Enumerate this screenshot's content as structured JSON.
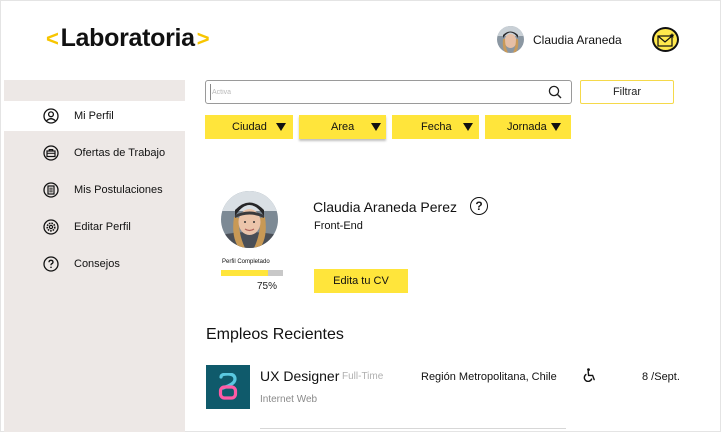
{
  "brand": {
    "left_bracket": "<",
    "name": "Laboratoria",
    "right_bracket": ">",
    "accent": "#f7c500"
  },
  "user": {
    "name": "Claudia Araneda",
    "avatar_icon": "user-photo",
    "notification_icon": "mail-star-icon"
  },
  "sidebar": {
    "items": [
      {
        "label": "Mi Perfil",
        "icon": "user-icon",
        "active": true
      },
      {
        "label": "Ofertas de Trabajo",
        "icon": "briefcase-icon",
        "active": false
      },
      {
        "label": "Mis Postulaciones",
        "icon": "document-icon",
        "active": false
      },
      {
        "label": "Editar Perfil",
        "icon": "gear-icon",
        "active": false
      },
      {
        "label": "Consejos",
        "icon": "question-icon",
        "active": false
      }
    ]
  },
  "search": {
    "placeholder": "Activa",
    "value": "",
    "icon": "search-icon",
    "filter_label": "Filtrar"
  },
  "filters": [
    {
      "label": "Ciudad"
    },
    {
      "label": "Area"
    },
    {
      "label": "Fecha"
    },
    {
      "label": "Jornada"
    }
  ],
  "profile": {
    "name": "Claudia Araneda Perez",
    "role": "Front-End",
    "completion_label": "Perfil Completado",
    "completion_text": "75%",
    "completion": 0.75,
    "cv_button": "Edita tu CV",
    "help_icon": "question-icon"
  },
  "jobs": {
    "title": "Empleos Recientes",
    "items": [
      {
        "title": "UX Designer",
        "type": "Full-Time",
        "company": "Internet Web",
        "location": "Región Metropolitana, Chile",
        "accessibility_icon": "wheelchair-icon",
        "date": "8 /Sept.",
        "logo_color": "#0f5a6b"
      }
    ]
  },
  "colors": {
    "yellow": "#ffe53b",
    "sidebar_bg": "#ede8e6",
    "logo_teal": "#0f5a6b"
  }
}
